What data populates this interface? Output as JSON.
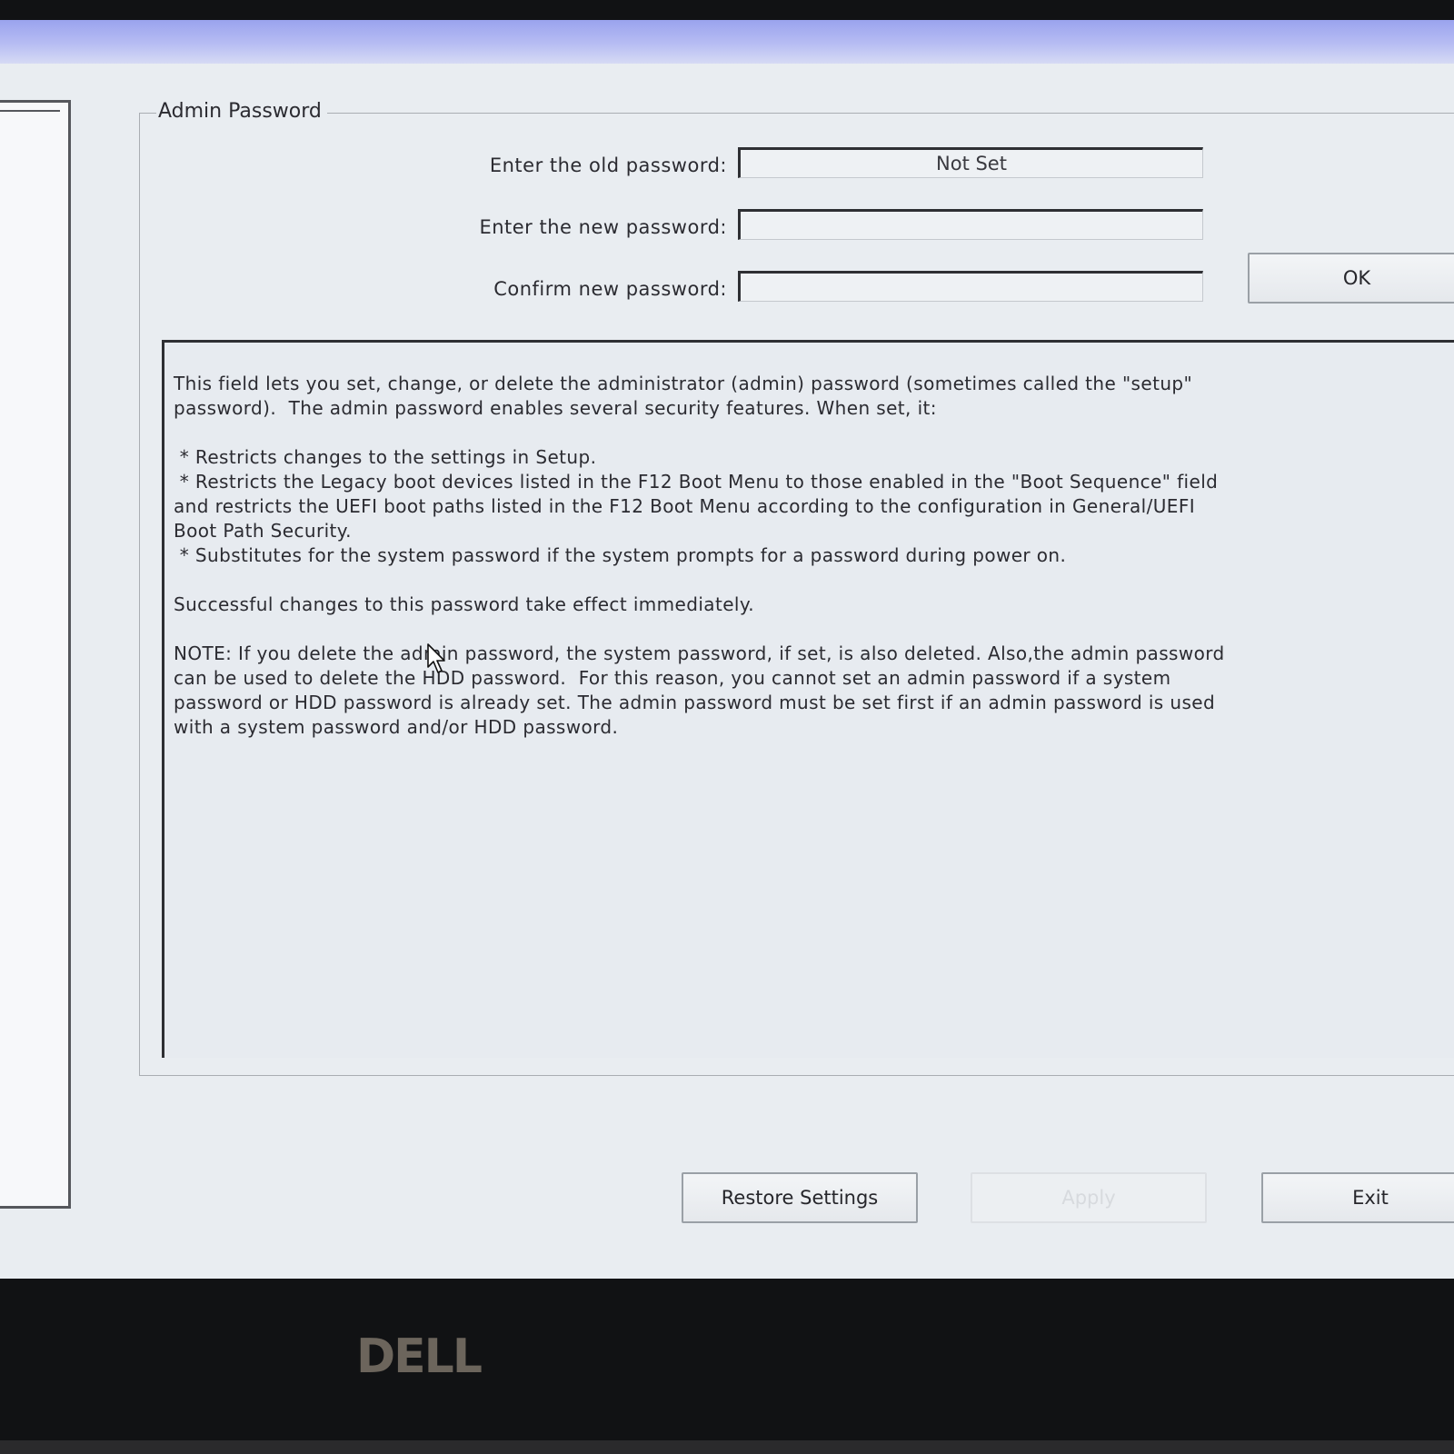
{
  "group": {
    "title": "Admin Password"
  },
  "fields": {
    "old_label": "Enter the old password:",
    "old_value": "Not Set",
    "new_label": "Enter the new password:",
    "new_value": "",
    "confirm_label": "Confirm new password:",
    "confirm_value": ""
  },
  "buttons": {
    "ok": "OK",
    "restore": "Restore Settings",
    "apply": "Apply",
    "exit": "Exit"
  },
  "help": {
    "intro": "This field lets you set, change, or delete the administrator (admin) password (sometimes called the \"setup\"\npassword).  The admin password enables several security features. When set, it:",
    "bullet1": " * Restricts changes to the settings in Setup.",
    "bullet2": " * Restricts the Legacy boot devices listed in the F12 Boot Menu to those enabled in the \"Boot Sequence\" field\nand restricts the UEFI boot paths listed in the F12 Boot Menu according to the configuration in General/UEFI\nBoot Path Security.",
    "bullet3": " * Substitutes for the system password if the system prompts for a password during power on.",
    "effect": "Successful changes to this password take effect immediately.",
    "note": "NOTE: If you delete the admin password, the system password, if set, is also deleted. Also,the admin password\ncan be used to delete the HDD password.  For this reason, you cannot set an admin password if a system\npassword or HDD password is already set. The admin password must be set first if an admin password is used\nwith a system password and/or HDD password."
  },
  "bezel": {
    "logo": "DELL"
  }
}
